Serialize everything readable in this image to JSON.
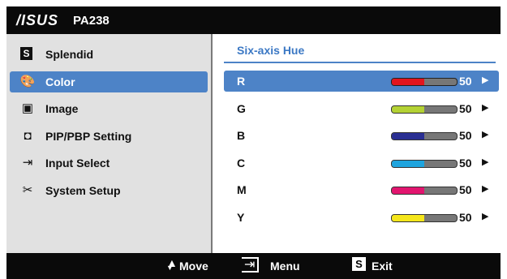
{
  "header": {
    "logo": "/ISUS",
    "model": "PA238"
  },
  "menu": {
    "items": [
      {
        "label": "Splendid",
        "icon": "splendid-s-icon",
        "glyph": "S",
        "selected": false
      },
      {
        "label": "Color",
        "icon": "color-palette-icon",
        "glyph": "🎨",
        "selected": true
      },
      {
        "label": "Image",
        "icon": "image-icon",
        "glyph": "▣",
        "selected": false
      },
      {
        "label": "PIP/PBP Setting",
        "icon": "pip-icon",
        "glyph": "◘",
        "selected": false
      },
      {
        "label": "Input Select",
        "icon": "input-select-icon",
        "glyph": "⇥",
        "selected": false
      },
      {
        "label": "System Setup",
        "icon": "tools-icon",
        "glyph": "✂",
        "selected": false
      }
    ]
  },
  "panel": {
    "title": "Six-axis Hue",
    "rows": [
      {
        "label": "R",
        "value": "50",
        "level": 0.5,
        "color": "#e3151d",
        "selected": true
      },
      {
        "label": "G",
        "value": "50",
        "level": 0.5,
        "color": "#b4d234",
        "selected": false
      },
      {
        "label": "B",
        "value": "50",
        "level": 0.5,
        "color": "#2a2f93",
        "selected": false
      },
      {
        "label": "C",
        "value": "50",
        "level": 0.5,
        "color": "#1ea4de",
        "selected": false
      },
      {
        "label": "M",
        "value": "50",
        "level": 0.5,
        "color": "#e2156f",
        "selected": false
      },
      {
        "label": "Y",
        "value": "50",
        "level": 0.5,
        "color": "#f5e61b",
        "selected": false
      }
    ]
  },
  "footer": {
    "move": "Move",
    "menu": "Menu",
    "exit": "Exit",
    "exit_glyph": "S"
  },
  "colors": {
    "accent": "#4d83c7",
    "panel_bg": "#e1e1e1",
    "bar": "#0a0a0a"
  }
}
